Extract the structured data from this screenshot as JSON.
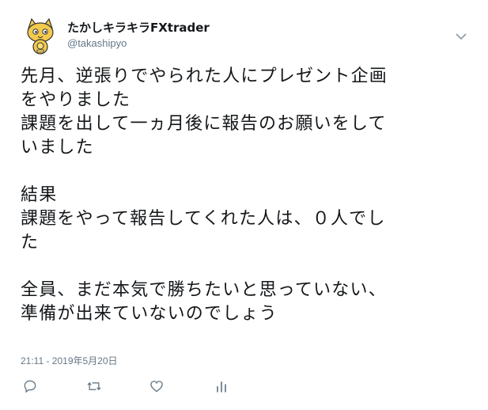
{
  "tweet": {
    "author_name": "たかしキラキラFXtrader",
    "author_handle": "@takashipyo",
    "text": "先月、逆張りでやられた人にプレゼント企画\nをやりました\n課題を出して一ヵ月後に報告のお願いをして\nいました\n\n結果\n課題をやって報告してくれた人は、０人でし\nた\n\n全員、まだ本気で勝ちたいと思っていない、\n準備が出来ていないのでしょう",
    "timestamp": "21:11 - 2019年5月20日"
  },
  "icons": {
    "avatar": "cartoon-cat-avatar",
    "menu": "chevron-down-icon",
    "reply": "reply-icon",
    "retweet": "retweet-icon",
    "like": "heart-icon",
    "analytics": "analytics-icon"
  },
  "colors": {
    "text": "#14171a",
    "secondary": "#657786",
    "icon": "#657786",
    "avatar_accent": "#f2c94c"
  }
}
